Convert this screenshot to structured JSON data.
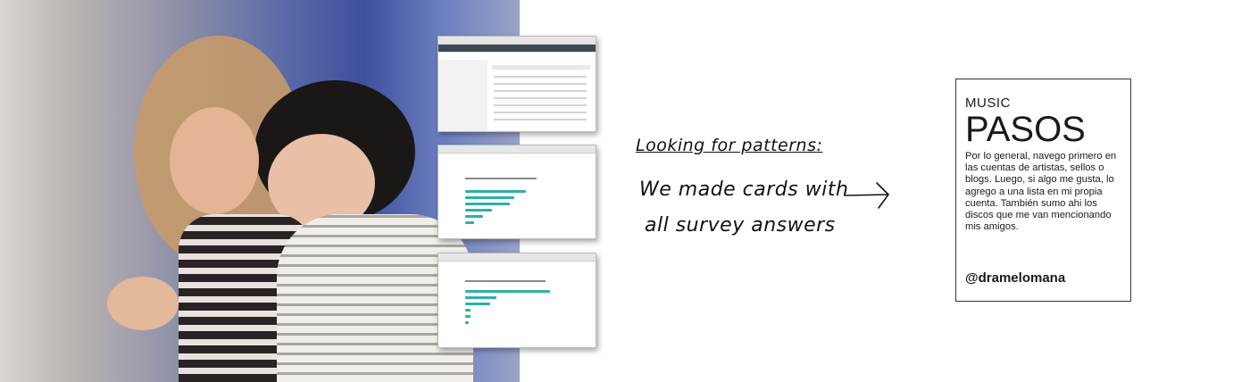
{
  "handwriting": {
    "heading": "Looking for patterns:",
    "line1": "We made cards with",
    "line2": "all survey answers"
  },
  "arrow_icon": "arrow-right-icon",
  "card": {
    "category": "MUSIC",
    "title": "PASOS",
    "body": "Por lo general, navego primero en las cuentas de artistas, sellos o blogs. Luego, si algo me gusta, lo agrego a una lista en mi propia cuenta. También sumo ahi los discos que me van mencionando mis amigos.",
    "handle": "@dramelomana"
  },
  "colors": {
    "accent": "#2bb0a8",
    "ink": "#1a1a1a"
  }
}
